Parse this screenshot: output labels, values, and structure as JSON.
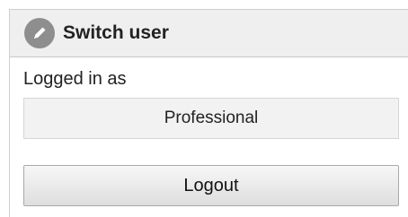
{
  "header": {
    "icon": "pencil-icon",
    "title": "Switch user"
  },
  "session": {
    "label": "Logged in as",
    "user": "Professional"
  },
  "actions": {
    "logout_label": "Logout"
  },
  "colors": {
    "header_bg": "#efefef",
    "icon_circle": "#8e8e8e",
    "button_top": "#f7f7f7",
    "button_bottom": "#dedede"
  }
}
